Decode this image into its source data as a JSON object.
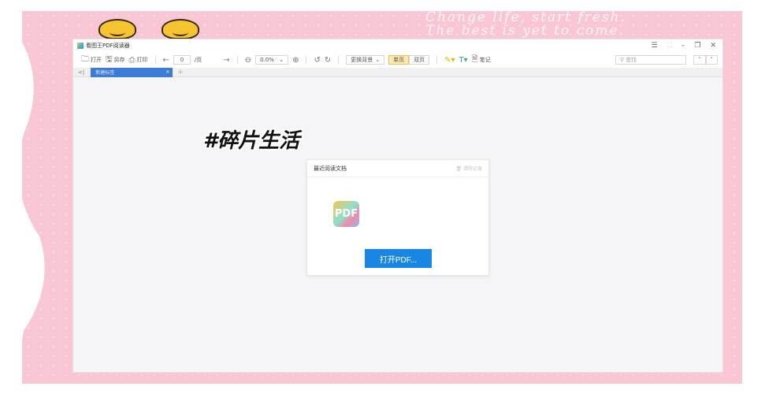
{
  "decoration": {
    "quote_line1": "Change life, start fresh.",
    "quote_line2": "The best is yet to come.",
    "hashtag": "#碎片生活"
  },
  "window": {
    "title": "看图王PDF阅读器",
    "controls": [
      "☰",
      "⛶",
      "–",
      "❐",
      "✕"
    ]
  },
  "toolbar": {
    "open": "打开",
    "save_as": "另存",
    "print": "打印",
    "page_value": "0",
    "page_suffix": "/页",
    "zoom_value": "0.0%",
    "background": "更换背景",
    "single_page": "单页",
    "double_page": "双页",
    "note": "笔记",
    "search_placeholder": "查找"
  },
  "tabs": {
    "current": "新建标签",
    "add": "+"
  },
  "recent": {
    "title": "最近阅读文档",
    "clear": "清除记录",
    "pdf_icon_text": "PDF",
    "open_button": "打开PDF..."
  }
}
